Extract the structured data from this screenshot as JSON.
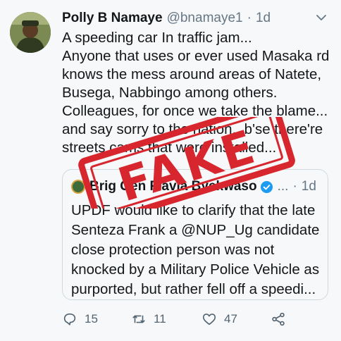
{
  "tweet": {
    "author_name": "Polly B Namaye",
    "author_handle": "@bnamaye1",
    "separator": "·",
    "time": "1d",
    "lines": [
      "A speeding car In traffic jam...",
      "Anyone that uses or ever used Masaka rd",
      "knows the mess around areas of Natete,",
      "Busega, Nabbingo among others.",
      "Colleagues, for once we take the blame...",
      "and say sorry to the nation.. b'se there're",
      "streets cams that were installed..."
    ]
  },
  "quoted": {
    "author_name": "Brig Gen Flavia Byekwaso",
    "ellipsis": "...",
    "separator": "·",
    "time": "1d",
    "lines": [
      "UPDF would like to clarify that the late",
      "Senteza Frank a @NUP_Ug candidate",
      "close protection person was not",
      "knocked by a Military Police Vehicle as",
      "purported, but rather fell off a speedi..."
    ]
  },
  "actions": {
    "reply_count": "15",
    "retweet_count": "11",
    "like_count": "47"
  },
  "stamp": {
    "text": "FAKE",
    "color": "#d7262d"
  },
  "icons": [
    "chevron-down-icon",
    "verified-badge-icon",
    "reply-icon",
    "retweet-icon",
    "like-icon",
    "share-icon"
  ]
}
